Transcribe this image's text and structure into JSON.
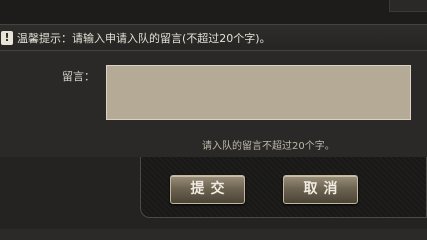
{
  "tip": {
    "icon": "exclamation-icon",
    "icon_glyph": "!",
    "text": "温馨提示：请输入申请入队的留言(不超过20个字)。"
  },
  "form": {
    "message_label": "留言：",
    "message_value": "",
    "hint": "请入队的留言不超过20个字。"
  },
  "buttons": {
    "submit": "提交",
    "cancel": "取消"
  },
  "colors": {
    "background": "#2b2a28",
    "textarea": "#b5aa96",
    "button_gold": "#8a7f6a"
  }
}
